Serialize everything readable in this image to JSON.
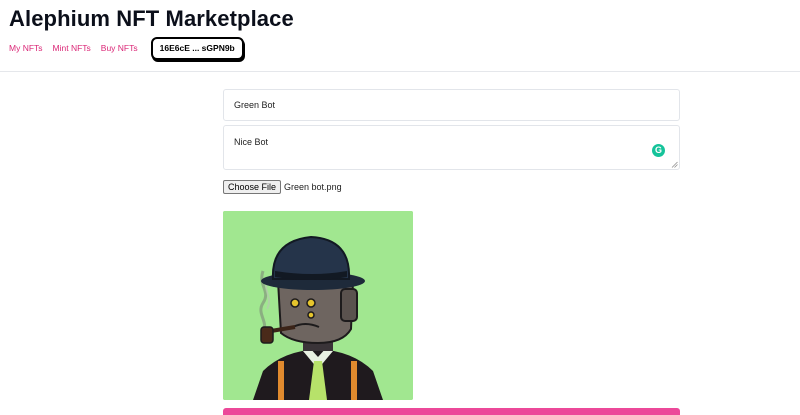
{
  "header": {
    "title": "Alephium NFT Marketplace"
  },
  "nav": {
    "items": [
      {
        "label": "My NFTs"
      },
      {
        "label": "Mint NFTs"
      },
      {
        "label": "Buy NFTs"
      }
    ],
    "wallet_address": "16E6cE ... sGPN9b"
  },
  "form": {
    "name_value": "Green Bot",
    "description_value": "Nice Bot",
    "file_button_label": "Choose File",
    "file_name": "Green bot.png",
    "preview_icon": "robot-nft-image",
    "preview_background": "#a1e790",
    "grammarly_icon_letter": "G"
  },
  "colors": {
    "accent": "#ec4899",
    "nav_link": "#db2777",
    "grammarly": "#15c39a"
  }
}
